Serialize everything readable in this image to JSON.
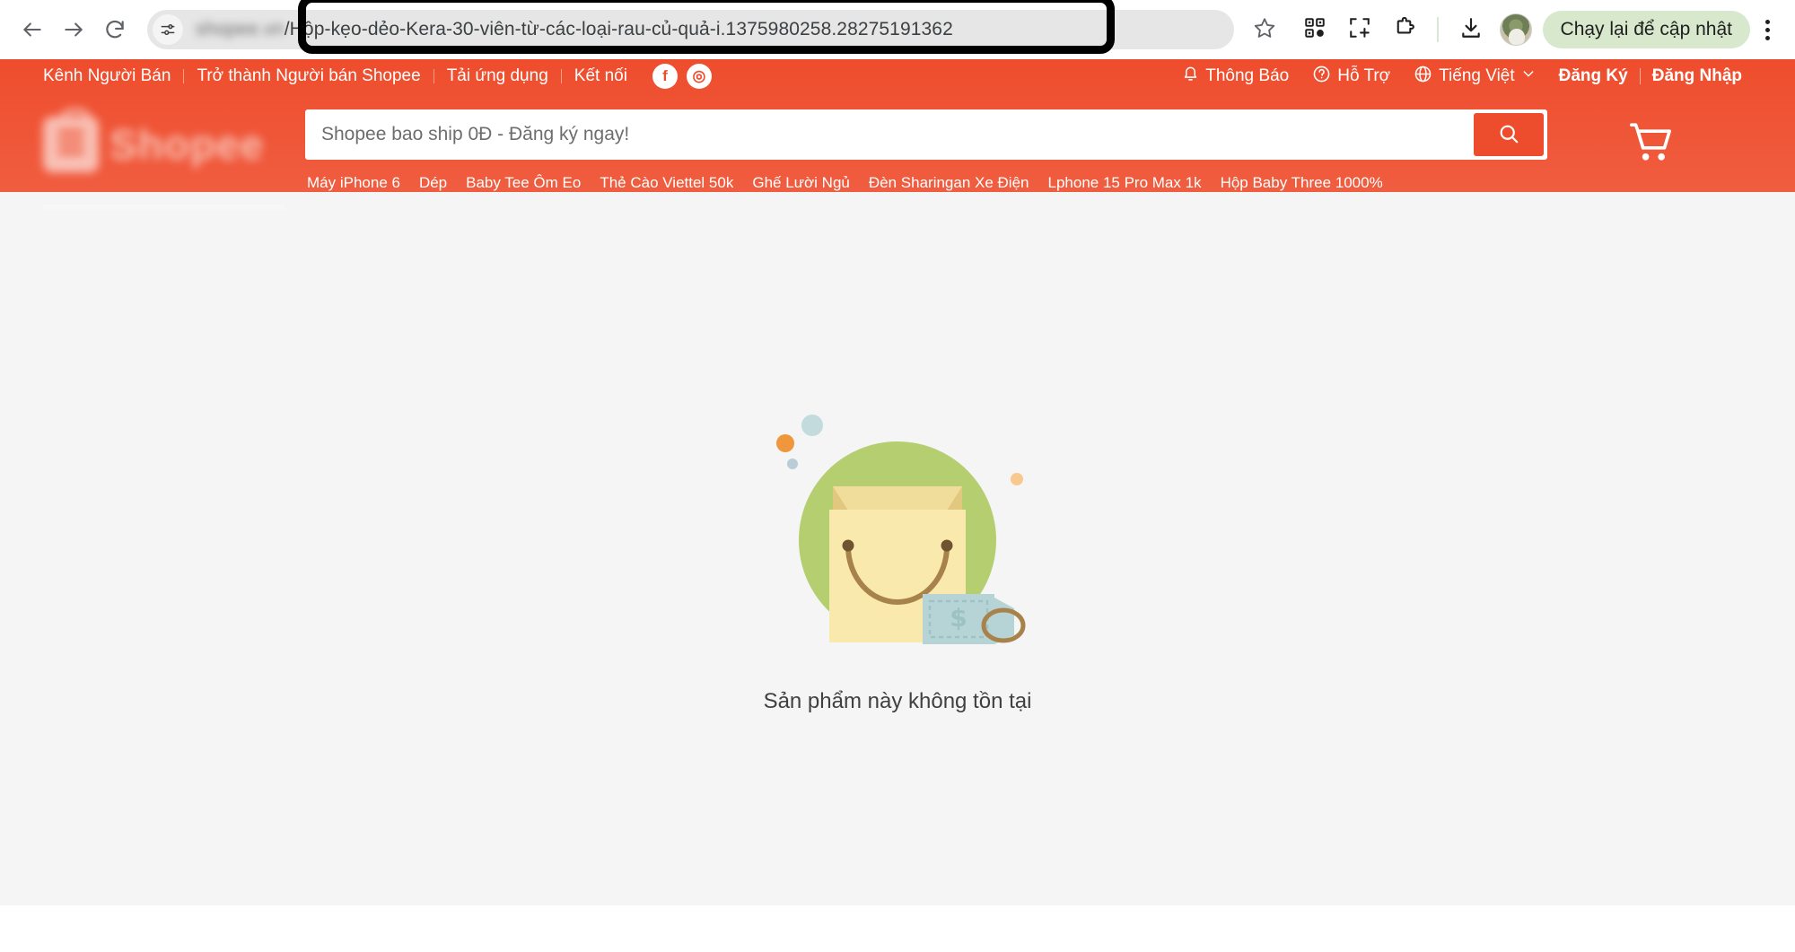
{
  "browser": {
    "back_icon": "arrow-left-icon",
    "forward_icon": "arrow-right-icon",
    "reload_icon": "reload-icon",
    "tune_icon": "site-settings-icon",
    "url_blurred": "shopee.vn",
    "url_visible": "/Hộp-kẹo-dẻo-Kera-30-viên-từ-các-loại-rau-củ-quả-i.1375980258.28275191362",
    "bookmark_icon": "star-icon",
    "qr_icon": "qr-code-icon",
    "capture_icon": "screen-capture-icon",
    "extensions_icon": "puzzle-piece-icon",
    "downloads_icon": "download-icon",
    "avatar_icon": "profile-avatar",
    "update_label": "Chạy lại để cập nhật",
    "menu_icon": "three-dot-menu-icon"
  },
  "topnav": {
    "left_items": [
      {
        "label": "Kênh Người Bán"
      },
      {
        "label": "Trở thành Người bán Shopee"
      },
      {
        "label": "Tải ứng dụng"
      },
      {
        "label": "Kết nối"
      }
    ],
    "social": [
      {
        "name": "facebook-icon",
        "glyph": "f"
      },
      {
        "name": "instagram-icon",
        "glyph": "◎"
      }
    ],
    "notification_label": "Thông Báo",
    "help_label": "Hỗ Trợ",
    "language_label": "Tiếng Việt",
    "signup_label": "Đăng Ký",
    "login_label": "Đăng Nhập"
  },
  "header": {
    "logo_text": "Shopee",
    "cart_icon": "shopping-cart-icon"
  },
  "search": {
    "placeholder": "Shopee bao ship 0Đ - Đăng ký ngay!",
    "value": "",
    "button_icon": "search-icon",
    "keywords": [
      "Máy iPhone 6",
      "Dép",
      "Baby Tee Ôm Eo",
      "Thẻ Cào Viettel 50k",
      "Ghế Lười Ngủ",
      "Đèn Sharingan Xe Điện",
      "Lphone 15 Pro Max 1k",
      "Hộp Baby Three 1000%"
    ]
  },
  "main": {
    "empty_illustration": "empty-shopping-bag-illustration",
    "empty_message": "Sản phẩm này không tồn tại"
  },
  "colors": {
    "brand_orange": "#ee4d2d",
    "page_bg": "#f5f5f5",
    "update_pill_bg": "#d7e8cd",
    "illus_circle_green": "#b5cf70",
    "illus_bag_yellow": "#f8e6a8",
    "illus_tag_blue": "#b6d4d6"
  }
}
